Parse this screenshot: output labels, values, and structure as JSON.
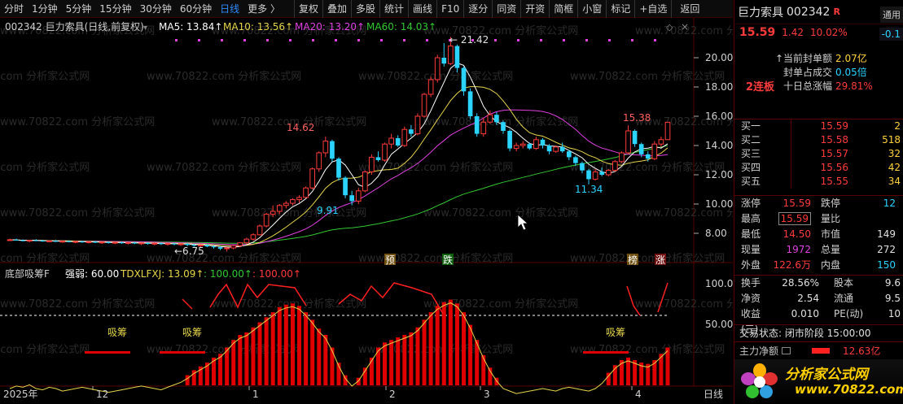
{
  "toolbar": {
    "periods": [
      "分时",
      "1分钟",
      "5分钟",
      "15分钟",
      "30分钟",
      "60分钟",
      "日线",
      "更多 〉"
    ],
    "active_period": "日线",
    "buttons": [
      "复权",
      "叠加",
      "多股",
      "统计",
      "画线",
      "F10",
      "逐分",
      "同资",
      "开资",
      "简框",
      "小窗",
      "标记",
      "+自选",
      "返回"
    ]
  },
  "main_legend": {
    "title": "002342 巨力索具(日线,前复权)",
    "ma5": "MA5: 13.84↑",
    "ma10": "MA10: 13.56↑",
    "ma20": "MA20: 13.20↑",
    "ma60": "MA60: 14.03↑"
  },
  "sub_legend": {
    "title": "底部吸筹F",
    "strength": "强弱: 60.00",
    "tdx": "TDXLFXJ: 13.09↑",
    "v1": ": 100.00↑",
    "v2": ": 100.00↑"
  },
  "price_axis": [
    "20.00",
    "18.00",
    "16.00",
    "14.00",
    "12.00",
    "10.00",
    "8.00"
  ],
  "sub_axis": [
    "100.0",
    "50.00"
  ],
  "date_axis": [
    "2025年",
    "12",
    "1",
    "2",
    "3",
    "4"
  ],
  "period_label": "日线",
  "annotations": {
    "high": "21.42",
    "p1462": "14.62",
    "p991": "9.91",
    "p675": "6.75",
    "p1538": "15.38",
    "p1134": "11.34",
    "tag_yu": "预",
    "tag_die": "跌",
    "tag_bang": "榜",
    "tag_zhang": "涨",
    "xichou": "吸筹"
  },
  "watermark": "www.70822.com 分析家公式网",
  "colors": {
    "up": "#ff3b3b",
    "down": "#2ad4ff",
    "ma5": "#ffffff",
    "ma10": "#e6d54a",
    "ma20": "#e040e0",
    "ma60": "#32c832"
  },
  "chart_data": {
    "type": "candlestick",
    "ylim": [
      6,
      22
    ],
    "ohlc": [
      [
        7.55,
        7.62,
        7.48,
        7.56
      ],
      [
        7.56,
        7.64,
        7.5,
        7.52
      ],
      [
        7.52,
        7.58,
        7.45,
        7.48
      ],
      [
        7.48,
        7.55,
        7.4,
        7.52
      ],
      [
        7.52,
        7.6,
        7.46,
        7.5
      ],
      [
        7.5,
        7.56,
        7.42,
        7.44
      ],
      [
        7.44,
        7.52,
        7.38,
        7.48
      ],
      [
        7.48,
        7.55,
        7.41,
        7.42
      ],
      [
        7.42,
        7.5,
        7.36,
        7.46
      ],
      [
        7.46,
        7.52,
        7.38,
        7.4
      ],
      [
        7.4,
        7.48,
        7.32,
        7.44
      ],
      [
        7.44,
        7.5,
        7.35,
        7.38
      ],
      [
        7.38,
        7.46,
        7.3,
        7.42
      ],
      [
        7.42,
        7.48,
        7.33,
        7.36
      ],
      [
        7.36,
        7.44,
        7.28,
        7.4
      ],
      [
        7.4,
        7.46,
        7.3,
        7.34
      ],
      [
        7.34,
        7.42,
        7.26,
        7.38
      ],
      [
        7.38,
        7.44,
        7.28,
        7.32
      ],
      [
        7.32,
        7.4,
        7.24,
        7.36
      ],
      [
        7.36,
        7.42,
        7.26,
        7.3
      ],
      [
        7.3,
        7.38,
        7.2,
        7.34
      ],
      [
        7.34,
        7.4,
        7.22,
        7.28
      ],
      [
        7.28,
        7.36,
        7.18,
        7.32
      ],
      [
        7.32,
        7.38,
        7.2,
        7.26
      ],
      [
        7.26,
        7.34,
        7.16,
        7.3
      ],
      [
        7.3,
        7.36,
        7.18,
        7.24
      ],
      [
        7.24,
        7.32,
        7.14,
        7.28
      ],
      [
        7.28,
        7.34,
        7.12,
        7.2
      ],
      [
        7.2,
        7.28,
        7.08,
        7.16
      ],
      [
        7.16,
        7.24,
        7.04,
        7.2
      ],
      [
        7.2,
        7.26,
        7.05,
        7.1
      ],
      [
        7.1,
        7.18,
        6.95,
        7.05
      ],
      [
        7.05,
        7.12,
        6.85,
        6.95
      ],
      [
        6.95,
        7.05,
        6.75,
        7.0
      ],
      [
        7.0,
        7.2,
        6.9,
        7.15
      ],
      [
        7.15,
        7.4,
        7.05,
        7.35
      ],
      [
        7.35,
        7.7,
        7.25,
        7.6
      ],
      [
        7.6,
        8.0,
        7.5,
        7.9
      ],
      [
        7.9,
        8.6,
        7.85,
        8.5
      ],
      [
        8.5,
        9.4,
        8.4,
        9.3
      ],
      [
        9.3,
        9.9,
        9.1,
        9.5
      ],
      [
        9.5,
        10.0,
        9.3,
        9.9
      ],
      [
        9.9,
        10.2,
        9.7,
        10.05
      ],
      [
        10.05,
        10.4,
        9.9,
        10.3
      ],
      [
        10.3,
        10.6,
        10.1,
        10.45
      ],
      [
        10.45,
        11.2,
        10.4,
        11.1
      ],
      [
        11.1,
        12.5,
        11.0,
        12.4
      ],
      [
        12.4,
        13.6,
        12.2,
        13.5
      ],
      [
        13.5,
        14.62,
        13.2,
        14.3
      ],
      [
        14.3,
        14.4,
        12.9,
        13.1
      ],
      [
        13.1,
        13.2,
        11.6,
        11.8
      ],
      [
        11.8,
        11.9,
        10.4,
        10.6
      ],
      [
        10.6,
        10.9,
        9.91,
        10.2
      ],
      [
        10.2,
        11.1,
        10.0,
        10.9
      ],
      [
        10.9,
        12.3,
        10.8,
        12.2
      ],
      [
        12.2,
        13.4,
        12.0,
        13.2
      ],
      [
        13.2,
        13.6,
        12.9,
        13.0
      ],
      [
        13.0,
        14.2,
        12.9,
        14.1
      ],
      [
        14.1,
        14.8,
        13.8,
        14.5
      ],
      [
        14.5,
        14.7,
        13.9,
        14.0
      ],
      [
        14.0,
        15.3,
        13.9,
        15.1
      ],
      [
        15.1,
        15.4,
        14.6,
        14.8
      ],
      [
        14.8,
        16.2,
        14.7,
        16.0
      ],
      [
        16.0,
        17.6,
        15.9,
        17.5
      ],
      [
        17.5,
        18.7,
        17.3,
        18.5
      ],
      [
        18.5,
        20.2,
        18.3,
        20.0
      ],
      [
        20.0,
        21.0,
        19.4,
        19.6
      ],
      [
        19.6,
        21.42,
        19.5,
        20.8
      ],
      [
        20.8,
        20.9,
        19.0,
        19.3
      ],
      [
        19.3,
        19.4,
        17.4,
        17.7
      ],
      [
        17.7,
        17.9,
        15.8,
        16.0
      ],
      [
        16.0,
        16.2,
        14.6,
        14.8
      ],
      [
        14.8,
        15.9,
        14.6,
        15.6
      ],
      [
        15.6,
        16.4,
        15.5,
        16.1
      ],
      [
        16.1,
        16.3,
        15.4,
        15.6
      ],
      [
        15.6,
        15.7,
        14.8,
        15.0
      ],
      [
        15.0,
        15.1,
        13.6,
        13.8
      ],
      [
        13.8,
        14.2,
        13.6,
        14.0
      ],
      [
        14.0,
        14.3,
        13.8,
        14.1
      ],
      [
        14.1,
        14.2,
        13.7,
        13.8
      ],
      [
        13.8,
        14.6,
        13.7,
        14.4
      ],
      [
        14.4,
        14.5,
        13.8,
        14.0
      ],
      [
        14.0,
        14.1,
        13.4,
        13.6
      ],
      [
        13.6,
        14.0,
        13.5,
        13.9
      ],
      [
        13.9,
        14.2,
        13.5,
        13.6
      ],
      [
        13.6,
        13.7,
        13.0,
        13.2
      ],
      [
        13.2,
        13.3,
        12.6,
        12.8
      ],
      [
        12.8,
        12.9,
        12.1,
        12.3
      ],
      [
        12.3,
        12.4,
        11.34,
        11.7
      ],
      [
        11.7,
        12.4,
        11.6,
        12.2
      ],
      [
        12.2,
        12.5,
        11.9,
        12.0
      ],
      [
        12.0,
        12.4,
        11.9,
        12.3
      ],
      [
        12.3,
        13.0,
        12.2,
        12.9
      ],
      [
        12.9,
        13.6,
        12.8,
        13.5
      ],
      [
        13.5,
        15.38,
        13.4,
        15.0
      ],
      [
        15.0,
        15.1,
        13.9,
        14.1
      ],
      [
        14.1,
        14.2,
        13.2,
        13.4
      ],
      [
        13.4,
        13.6,
        12.9,
        13.1
      ],
      [
        13.1,
        14.3,
        13.0,
        14.1
      ],
      [
        14.1,
        14.6,
        13.9,
        14.4
      ],
      [
        14.4,
        15.59,
        14.5,
        15.59
      ]
    ],
    "sub_values": [
      30,
      32,
      31,
      33,
      30,
      29,
      31,
      30,
      28,
      29,
      30,
      31,
      30,
      29,
      28,
      27,
      28,
      29,
      30,
      31,
      32,
      31,
      30,
      29,
      31,
      33,
      35,
      38,
      42,
      45,
      48,
      52,
      55,
      60,
      66,
      70,
      72,
      76,
      80,
      84,
      88,
      92,
      94,
      95,
      93,
      88,
      82,
      75,
      70,
      60,
      48,
      38,
      32,
      36,
      44,
      52,
      60,
      64,
      66,
      68,
      70,
      72,
      76,
      82,
      88,
      93,
      96,
      98,
      95,
      88,
      78,
      66,
      54,
      44,
      36,
      30,
      28,
      26,
      27,
      28,
      29,
      30,
      29,
      28,
      30,
      31,
      30,
      29,
      28,
      30,
      34,
      40,
      46,
      50,
      52,
      50,
      48,
      47,
      50,
      55,
      60
    ]
  }
}
